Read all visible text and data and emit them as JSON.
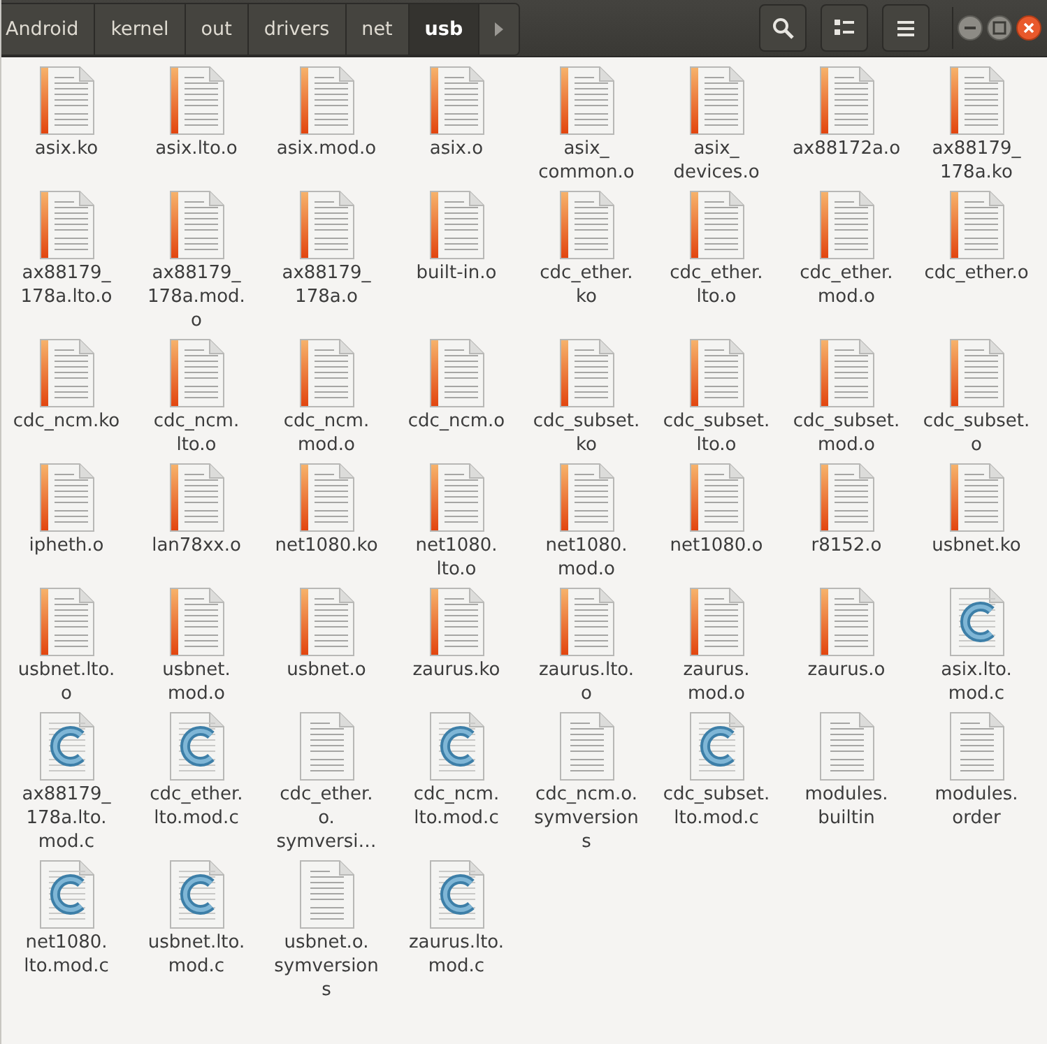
{
  "breadcrumbs": [
    {
      "label": "Android",
      "selected": false
    },
    {
      "label": "kernel",
      "selected": false
    },
    {
      "label": "out",
      "selected": false
    },
    {
      "label": "drivers",
      "selected": false
    },
    {
      "label": "net",
      "selected": false
    },
    {
      "label": "usb",
      "selected": true
    }
  ],
  "files": [
    {
      "kind": "text",
      "lines": [
        "asix.ko"
      ]
    },
    {
      "kind": "text",
      "lines": [
        "asix.lto.o"
      ]
    },
    {
      "kind": "text",
      "lines": [
        "asix.mod.o"
      ]
    },
    {
      "kind": "text",
      "lines": [
        "asix.o"
      ]
    },
    {
      "kind": "text",
      "lines": [
        "asix_",
        "common.o"
      ]
    },
    {
      "kind": "text",
      "lines": [
        "asix_",
        "devices.o"
      ]
    },
    {
      "kind": "text",
      "lines": [
        "ax88172a.o"
      ]
    },
    {
      "kind": "text",
      "lines": [
        "ax88179_",
        "178a.ko"
      ]
    },
    {
      "kind": "text",
      "lines": [
        "ax88179_",
        "178a.lto.o"
      ]
    },
    {
      "kind": "text",
      "lines": [
        "ax88179_",
        "178a.mod.",
        "o"
      ]
    },
    {
      "kind": "text",
      "lines": [
        "ax88179_",
        "178a.o"
      ]
    },
    {
      "kind": "text",
      "lines": [
        "built-in.o"
      ]
    },
    {
      "kind": "text",
      "lines": [
        "cdc_ether.",
        "ko"
      ]
    },
    {
      "kind": "text",
      "lines": [
        "cdc_ether.",
        "lto.o"
      ]
    },
    {
      "kind": "text",
      "lines": [
        "cdc_ether.",
        "mod.o"
      ]
    },
    {
      "kind": "text",
      "lines": [
        "cdc_ether.o"
      ]
    },
    {
      "kind": "text",
      "lines": [
        "cdc_ncm.ko"
      ]
    },
    {
      "kind": "text",
      "lines": [
        "cdc_ncm.",
        "lto.o"
      ]
    },
    {
      "kind": "text",
      "lines": [
        "cdc_ncm.",
        "mod.o"
      ]
    },
    {
      "kind": "text",
      "lines": [
        "cdc_ncm.o"
      ]
    },
    {
      "kind": "text",
      "lines": [
        "cdc_subset.",
        "ko"
      ]
    },
    {
      "kind": "text",
      "lines": [
        "cdc_subset.",
        "lto.o"
      ]
    },
    {
      "kind": "text",
      "lines": [
        "cdc_subset.",
        "mod.o"
      ]
    },
    {
      "kind": "text",
      "lines": [
        "cdc_subset.",
        "o"
      ]
    },
    {
      "kind": "text",
      "lines": [
        "ipheth.o"
      ]
    },
    {
      "kind": "text",
      "lines": [
        "lan78xx.o"
      ]
    },
    {
      "kind": "text",
      "lines": [
        "net1080.ko"
      ]
    },
    {
      "kind": "text",
      "lines": [
        "net1080.",
        "lto.o"
      ]
    },
    {
      "kind": "text",
      "lines": [
        "net1080.",
        "mod.o"
      ]
    },
    {
      "kind": "text",
      "lines": [
        "net1080.o"
      ]
    },
    {
      "kind": "text",
      "lines": [
        "r8152.o"
      ]
    },
    {
      "kind": "text",
      "lines": [
        "usbnet.ko"
      ]
    },
    {
      "kind": "text",
      "lines": [
        "usbnet.lto.",
        "o"
      ]
    },
    {
      "kind": "text",
      "lines": [
        "usbnet.",
        "mod.o"
      ]
    },
    {
      "kind": "text",
      "lines": [
        "usbnet.o"
      ]
    },
    {
      "kind": "text",
      "lines": [
        "zaurus.ko"
      ]
    },
    {
      "kind": "text",
      "lines": [
        "zaurus.lto.",
        "o"
      ]
    },
    {
      "kind": "text",
      "lines": [
        "zaurus.",
        "mod.o"
      ]
    },
    {
      "kind": "text",
      "lines": [
        "zaurus.o"
      ]
    },
    {
      "kind": "c",
      "lines": [
        "asix.lto.",
        "mod.c"
      ]
    },
    {
      "kind": "c",
      "lines": [
        "ax88179_",
        "178a.lto.",
        "mod.c"
      ]
    },
    {
      "kind": "c",
      "lines": [
        "cdc_ether.",
        "lto.mod.c"
      ]
    },
    {
      "kind": "plain",
      "lines": [
        "cdc_ether.",
        "o.",
        "symversi…"
      ]
    },
    {
      "kind": "c",
      "lines": [
        "cdc_ncm.",
        "lto.mod.c"
      ]
    },
    {
      "kind": "plain",
      "lines": [
        "cdc_ncm.o.",
        "symversion",
        "s"
      ]
    },
    {
      "kind": "c",
      "lines": [
        "cdc_subset.",
        "lto.mod.c"
      ]
    },
    {
      "kind": "plain",
      "lines": [
        "modules.",
        "builtin"
      ]
    },
    {
      "kind": "plain",
      "lines": [
        "modules.",
        "order"
      ]
    },
    {
      "kind": "c",
      "lines": [
        "net1080.",
        "lto.mod.c"
      ]
    },
    {
      "kind": "c",
      "lines": [
        "usbnet.lto.",
        "mod.c"
      ]
    },
    {
      "kind": "plain",
      "lines": [
        "usbnet.o.",
        "symversion",
        "s"
      ]
    },
    {
      "kind": "c",
      "lines": [
        "zaurus.lto.",
        "mod.c"
      ]
    }
  ]
}
